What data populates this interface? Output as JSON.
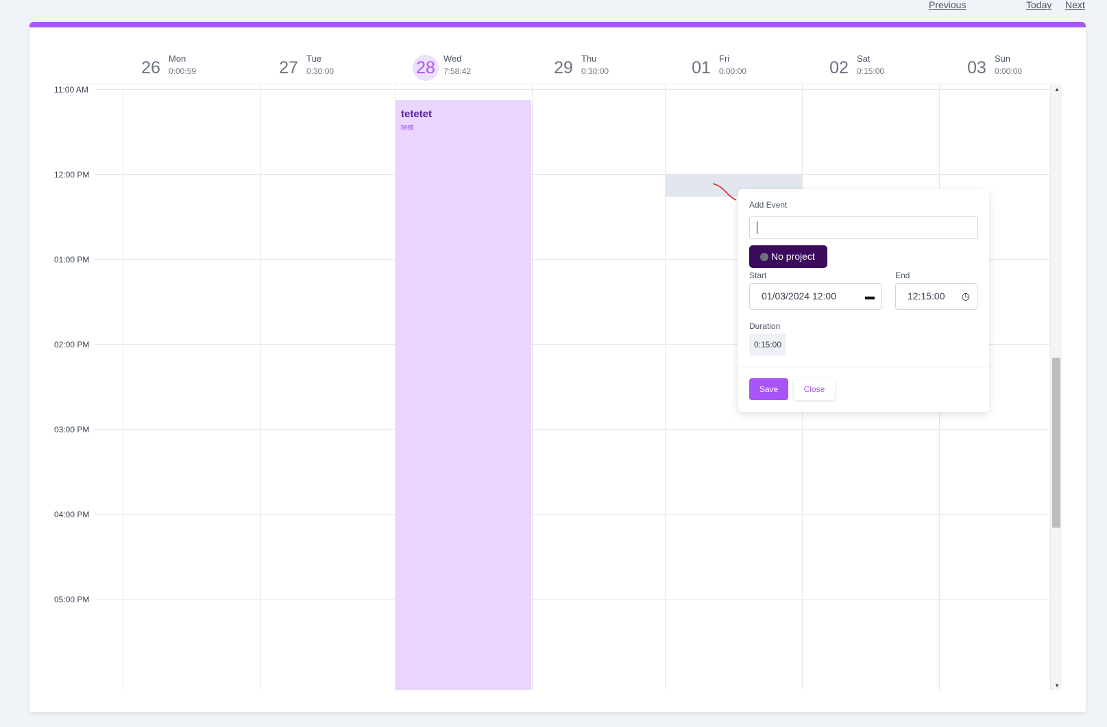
{
  "nav": {
    "previous": "Previous",
    "today": "Today",
    "next": "Next"
  },
  "days": [
    {
      "num": "26",
      "name": "Mon",
      "duration": "0:00:59"
    },
    {
      "num": "27",
      "name": "Tue",
      "duration": "0:30:00"
    },
    {
      "num": "28",
      "name": "Wed",
      "duration": "7:58:42"
    },
    {
      "num": "29",
      "name": "Thu",
      "duration": "0:30:00"
    },
    {
      "num": "01",
      "name": "Fri",
      "duration": "0:00:00"
    },
    {
      "num": "02",
      "name": "Sat",
      "duration": "0:15:00"
    },
    {
      "num": "03",
      "name": "Sun",
      "duration": "0:00:00"
    }
  ],
  "hours": [
    "11:00 AM",
    "12:00 PM",
    "01:00 PM",
    "02:00 PM",
    "03:00 PM",
    "04:00 PM",
    "05:00 PM"
  ],
  "event": {
    "title": "tetetet",
    "project": "test",
    "color": "#e9d5fe"
  },
  "popup": {
    "heading": "Add Event",
    "title_value": "",
    "project_label": "No project",
    "start_label": "Start",
    "start_value": "01/03/2024 12:00",
    "end_label": "End",
    "end_value": "12:15:00",
    "duration_label": "Duration",
    "duration_value": "0:15:00",
    "save_label": "Save",
    "close_label": "Close"
  },
  "colors": {
    "accent": "#a855f7",
    "project_button": "#3b0a5c",
    "today_bg": "#ede0fb"
  }
}
